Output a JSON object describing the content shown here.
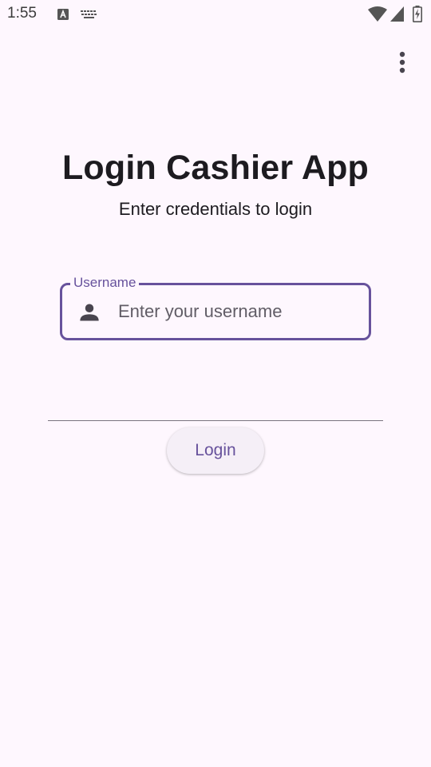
{
  "status_bar": {
    "time": "1:55",
    "icons": [
      "text-a-icon",
      "keyboard-icon",
      "wifi-icon",
      "cell-signal-icon",
      "battery-charging-icon"
    ]
  },
  "app_bar": {
    "overflow_icon": "more-vert-icon"
  },
  "header": {
    "title": "Login Cashier App",
    "subtitle": "Enter credentials to login"
  },
  "form": {
    "username": {
      "label": "Username",
      "placeholder": "Enter your username",
      "value": "",
      "icon": "person-icon",
      "state": "focused"
    },
    "password": {
      "placeholder": "",
      "value": ""
    },
    "login_label": "Login"
  },
  "colors": {
    "background": "#fef7fe",
    "primary": "#67529c",
    "text": "#1d1b20",
    "button_bg": "#f5eff7"
  }
}
